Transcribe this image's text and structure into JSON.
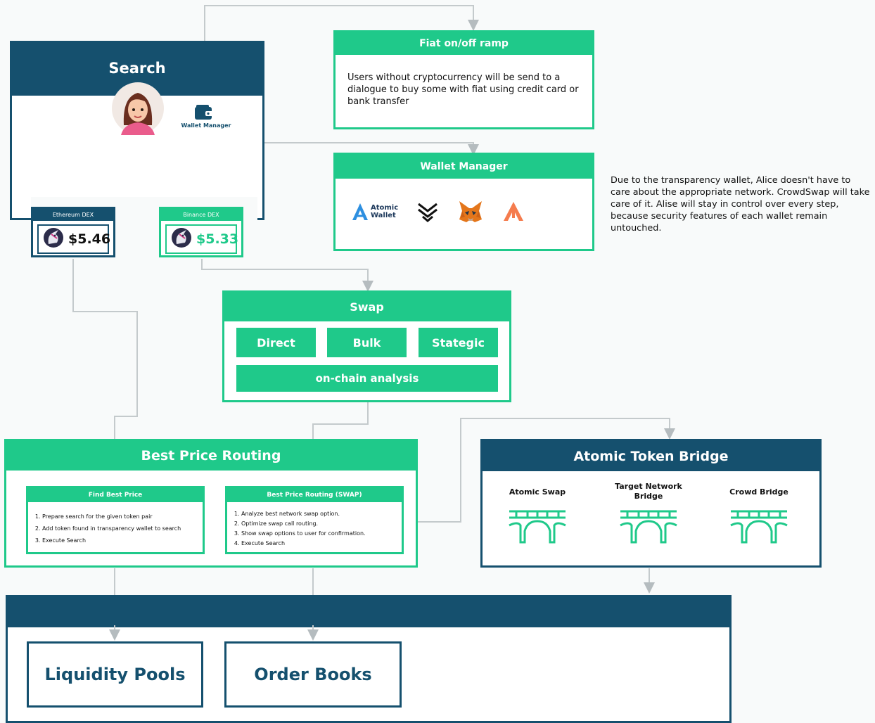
{
  "search": {
    "title": "Search",
    "wallet_manager_label": "Wallet Manager",
    "dex_left": {
      "label": "Ethereum DEX",
      "price": "$5.46"
    },
    "dex_right": {
      "label": "Binance DEX",
      "price": "$5.33"
    }
  },
  "fiat": {
    "title": "Fiat on/off ramp",
    "text": "Users without cryptocurrency will be send to a dialogue to buy some with fiat using credit card or bank transfer"
  },
  "wallet_manager": {
    "title": "Wallet Manager",
    "atomic_wallet_label_1": "Atomic",
    "atomic_wallet_label_2": "Wallet",
    "icons": [
      "atomic-wallet-icon",
      "xdefi-chevrons-icon",
      "metamask-fox-icon",
      "arkane-icon"
    ]
  },
  "note": "Due to the transparency wallet, Alice doesn't have to care about the appropriate network. CrowdSwap will take care of it. Alise will stay in control over every step, because security features of each wallet remain untouched.",
  "swap": {
    "title": "Swap",
    "direct": "Direct",
    "bulk": "Bulk",
    "strategic": "Stategic",
    "onchain": "on-chain analysis"
  },
  "best_price_routing": {
    "title": "Best Price Routing",
    "find": {
      "title": "Find Best Price",
      "steps": [
        "Prepare search for the given token pair",
        "Add token found in transparency wallet to search",
        "Execute Search"
      ]
    },
    "routing": {
      "title": "Best Price Routing (SWAP)",
      "steps": [
        "Analyze best network swap option.",
        "Optimize swap call routing.",
        "Show swap options to user for confirmation.",
        "Execute Search"
      ]
    }
  },
  "bridge": {
    "title": "Atomic Token Bridge",
    "items": [
      "Atomic Swap",
      "Target Network Bridge",
      "Crowd Bridge"
    ]
  },
  "bottom": {
    "liquidity": "Liquidity Pools",
    "orderbooks": "Order Books"
  },
  "colors": {
    "green": "#1fc98a",
    "navy": "#15506e"
  }
}
